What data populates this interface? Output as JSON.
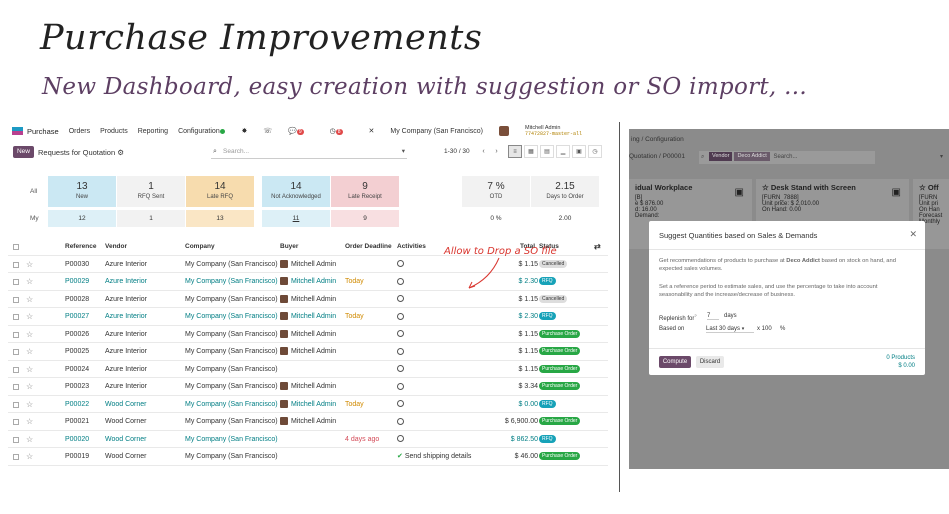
{
  "heading": {
    "title": "Purchase Improvements",
    "subtitle": "New Dashboard, easy creation with suggestion or SO import, ..."
  },
  "left": {
    "nav": {
      "app": "Purchase",
      "menu": [
        "Orders",
        "Products",
        "Reporting",
        "Configuration"
      ],
      "badge1": "9",
      "badge2": "8",
      "company": "My Company (San Francisco)",
      "user": "Mitchell Admin",
      "db": "77472827-master-all"
    },
    "control": {
      "new_label": "New",
      "breadcrumb": "Requests for Quotation",
      "search_placeholder": "Search...",
      "pager": "1-30 / 30"
    },
    "dashboard": {
      "row_all": "All",
      "row_my": "My",
      "cards": [
        {
          "num": "13",
          "label": "New",
          "my": "12"
        },
        {
          "num": "1",
          "label": "RFQ Sent",
          "my": "1"
        },
        {
          "num": "14",
          "label": "Late RFQ",
          "my": "13"
        },
        {
          "num": "14",
          "label": "Not Acknowledged",
          "my": "11"
        },
        {
          "num": "9",
          "label": "Late Receipt",
          "my": "9"
        }
      ],
      "kpis": [
        {
          "num": "7 %",
          "label": "OTD",
          "my": "0 %"
        },
        {
          "num": "2.15",
          "label": "Days to Order",
          "my": "2.00"
        }
      ]
    },
    "table": {
      "headers": [
        "Reference",
        "Vendor",
        "Company",
        "Buyer",
        "Order Deadline",
        "Activities",
        "Total",
        "Status"
      ],
      "rows": [
        {
          "ref": "P00030",
          "vendor": "Azure Interior",
          "company": "My Company (San Francisco)",
          "buyer": "Mitchell Admin",
          "deadline": "",
          "activity": "",
          "total": "$ 1.15",
          "status": "Cancelled"
        },
        {
          "ref": "P00029",
          "vendor": "Azure Interior",
          "company": "My Company (San Francisco)",
          "buyer": "Mitchell Admin",
          "deadline": "Today",
          "activity": "",
          "total": "$ 2.30",
          "status": "RFQ"
        },
        {
          "ref": "P00028",
          "vendor": "Azure Interior",
          "company": "My Company (San Francisco)",
          "buyer": "Mitchell Admin",
          "deadline": "",
          "activity": "",
          "total": "$ 1.15",
          "status": "Cancelled"
        },
        {
          "ref": "P00027",
          "vendor": "Azure Interior",
          "company": "My Company (San Francisco)",
          "buyer": "Mitchell Admin",
          "deadline": "Today",
          "activity": "",
          "total": "$ 2.30",
          "status": "RFQ"
        },
        {
          "ref": "P00026",
          "vendor": "Azure Interior",
          "company": "My Company (San Francisco)",
          "buyer": "Mitchell Admin",
          "deadline": "",
          "activity": "",
          "total": "$ 1.15",
          "status": "Purchase Order"
        },
        {
          "ref": "P00025",
          "vendor": "Azure Interior",
          "company": "My Company (San Francisco)",
          "buyer": "Mitchell Admin",
          "deadline": "",
          "activity": "",
          "total": "$ 1.15",
          "status": "Purchase Order"
        },
        {
          "ref": "P00024",
          "vendor": "Azure Interior",
          "company": "My Company (San Francisco)",
          "buyer": "",
          "deadline": "",
          "activity": "",
          "total": "$ 1.15",
          "status": "Purchase Order"
        },
        {
          "ref": "P00023",
          "vendor": "Azure Interior",
          "company": "My Company (San Francisco)",
          "buyer": "Mitchell Admin",
          "deadline": "",
          "activity": "",
          "total": "$ 3.34",
          "status": "Purchase Order"
        },
        {
          "ref": "P00022",
          "vendor": "Wood Corner",
          "company": "My Company (San Francisco)",
          "buyer": "Mitchell Admin",
          "deadline": "Today",
          "activity": "",
          "total": "$ 0.00",
          "status": "RFQ"
        },
        {
          "ref": "P00021",
          "vendor": "Wood Corner",
          "company": "My Company (San Francisco)",
          "buyer": "Mitchell Admin",
          "deadline": "",
          "activity": "",
          "total": "$ 6,900.00",
          "status": "Purchase Order"
        },
        {
          "ref": "P00020",
          "vendor": "Wood Corner",
          "company": "My Company (San Francisco)",
          "buyer": "",
          "deadline": "4 days ago",
          "activity": "",
          "total": "$ 862.50",
          "status": "RFQ"
        },
        {
          "ref": "P00019",
          "vendor": "Wood Corner",
          "company": "My Company (San Francisco)",
          "buyer": "",
          "deadline": "",
          "activity": "Send shipping details",
          "total": "$ 46.00",
          "status": "Purchase Order"
        }
      ]
    },
    "annotation": "Allow to Drop a SO file"
  },
  "right": {
    "breadcrumb1": "ing / Configuration",
    "breadcrumb2": "Quotation / P00001",
    "search_chip_key": "Vendor",
    "search_chip_val": "Deco Addict",
    "search_placeholder": "Search...",
    "cards": [
      {
        "title": "idual Workplace",
        "l1": "[B]",
        "l2": "e $ 876.00",
        "l3": "d: 16.00",
        "l4": "Demand: "
      },
      {
        "title": "Desk Stand with Screen",
        "l1": "[FURN_7888]",
        "l2": "Unit price: $ 2,010.00",
        "l3": "On Hand: 0.00",
        "l4": ""
      },
      {
        "title": "Off",
        "l1": "[FURN",
        "l2": "Unit pri",
        "l3": "On Han",
        "l4": "Forecast Monthly"
      }
    ],
    "modal": {
      "title": "Suggest Quantities based on Sales & Demands",
      "p1a": "Get recommendations of products to purchase at",
      "p1b": "Deco Addict",
      "p1c": "based on stock on hand, and expected sales volumes.",
      "p2": "Set a reference period to estimate sales, and use the percentage to take into account seasonability and the increase/decrease of business.",
      "replenish_label": "Replenish for",
      "replenish_value": "7",
      "replenish_unit": "days",
      "based_label": "Based on",
      "based_value": "Last 30 days",
      "multiplier": "x 100",
      "percent": "%",
      "compute": "Compute",
      "discard": "Discard",
      "total_products": "0 Products",
      "total_value": "$ 0.00"
    }
  }
}
